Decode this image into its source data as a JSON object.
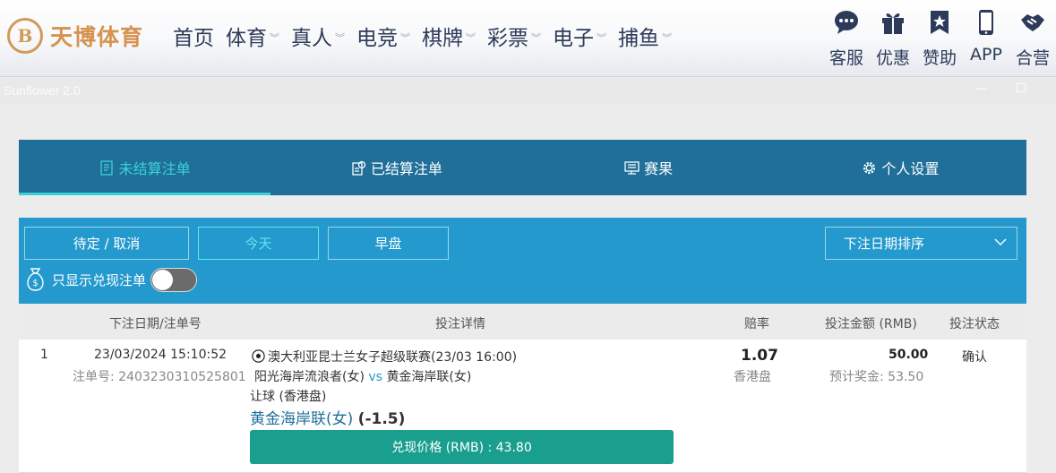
{
  "brand": {
    "mark": "B",
    "name": "天博体育"
  },
  "nav": [
    {
      "label": "首页",
      "dropdown": false
    },
    {
      "label": "体育",
      "dropdown": true
    },
    {
      "label": "真人",
      "dropdown": true
    },
    {
      "label": "电竞",
      "dropdown": true
    },
    {
      "label": "棋牌",
      "dropdown": true
    },
    {
      "label": "彩票",
      "dropdown": true
    },
    {
      "label": "电子",
      "dropdown": true
    },
    {
      "label": "捕鱼",
      "dropdown": true
    }
  ],
  "quick_links": [
    {
      "label": "客服",
      "icon": "chat-icon"
    },
    {
      "label": "优惠",
      "icon": "gift-icon"
    },
    {
      "label": "赞助",
      "icon": "star-badge-icon"
    },
    {
      "label": "APP",
      "icon": "phone-icon"
    },
    {
      "label": "合营",
      "icon": "handshake-icon"
    }
  ],
  "window": {
    "title": "Sunflower 2.0",
    "minimize": "—",
    "maximize": "☐"
  },
  "tabs": [
    {
      "label": "未结算注单",
      "icon": "unsettled-icon",
      "active": true
    },
    {
      "label": "已结算注单",
      "icon": "settled-icon",
      "active": false
    },
    {
      "label": "赛果",
      "icon": "results-icon",
      "active": false
    },
    {
      "label": "个人设置",
      "icon": "gear-icon",
      "active": false
    }
  ],
  "filters": {
    "buttons": [
      {
        "label": "待定 / 取消",
        "active": false
      },
      {
        "label": "今天",
        "active": true
      },
      {
        "label": "早盘",
        "active": false
      }
    ],
    "sort_label": "下注日期排序",
    "cashout_only_label": "只显示兑现注单",
    "cashout_only_on": false
  },
  "table": {
    "headers": {
      "date": "下注日期/注单号",
      "detail": "投注详情",
      "odds": "赔率",
      "amount": "投注金额 (RMB)",
      "status": "投注状态"
    },
    "rows": [
      {
        "index": "1",
        "datetime": "23/03/2024 15:10:52",
        "bet_no": "注单号: 2403230310525801",
        "league": "澳大利亚昆士兰女子超级联赛(23/03 16:00)",
        "home": "阳光海岸流浪者(女)",
        "vs": "vs",
        "away": "黄金海岸联(女)",
        "market": "让球 (香港盘)",
        "selection": "黄金海岸联(女)",
        "handicap": "(-1.5)",
        "odds": "1.07",
        "odds_type": "香港盘",
        "stake": "50.00",
        "est_payout": "预计奖金: 53.50",
        "status": "确认",
        "cashout_label": "兑现价格 (RMB) : 43.80"
      }
    ]
  },
  "colors": {
    "tab_bar": "#1f6f99",
    "filter_panel": "#2399cd",
    "active_accent": "#39d2d6",
    "cashout_button": "#1a9f8f",
    "brand_gold": "#d6924f"
  }
}
